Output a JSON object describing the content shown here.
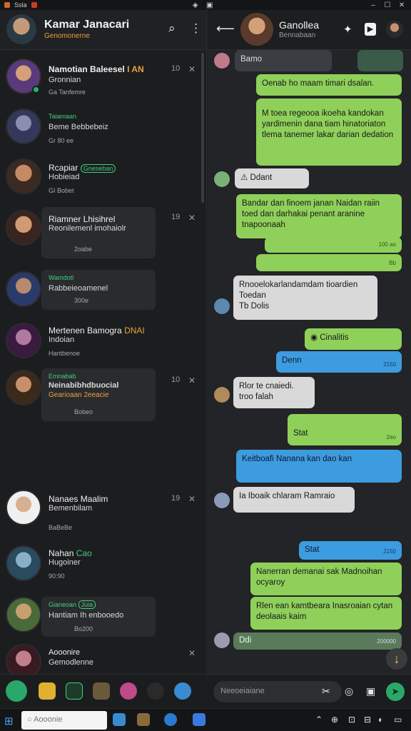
{
  "system_bar": {
    "left_text": "Ssla",
    "right_icons": [
      "shield-icon",
      "tray-icon",
      "tray-icon"
    ]
  },
  "left": {
    "header": {
      "title": "Kamar Janacari",
      "subtitle": "Genomonerne"
    },
    "chats": [
      {
        "name": "Namotian Baleesel",
        "name_tag": "I AN",
        "preview": "Gronnian",
        "meta": "Ga Tanfemre",
        "time": "10"
      },
      {
        "name": "Taiamaan",
        "preview": "Beme Bebbebeiz",
        "meta": "Gr  80 ee",
        "time": ""
      },
      {
        "name": "Rcapiar",
        "name_tag": "Gneseban",
        "preview": "Hobieiad",
        "meta": "GI  Bobet",
        "time": ""
      },
      {
        "name": "Riamner Lhisihrel",
        "preview": "Reonilemenl imohaiolr",
        "meta": "2oabe",
        "time": "19"
      },
      {
        "name": "Wamdotl",
        "preview": "Rabbeieoamenel",
        "meta": "300e",
        "time": ""
      },
      {
        "name": "Mertenen Bamogra",
        "name_tag": "DNAI",
        "preview": "Indoian",
        "meta": "Hantbenoe",
        "time": ""
      },
      {
        "name": "Emnabab",
        "preview": "Neinabibhdbuocial",
        "preview2": "Gearioaan",
        "meta_tag": "2eeacie",
        "meta": "Bobeo",
        "time": "10"
      },
      {
        "name": "Nanaes Maalim",
        "preview": "Bemenbilam",
        "meta": "BaBeBe",
        "time": "19"
      },
      {
        "name": "Nahan",
        "name_tag": "Cao",
        "preview": "Hugoiner",
        "meta": "90:90",
        "time": ""
      },
      {
        "name": "Gianeoan",
        "name_tag": "Juia",
        "preview": "Hantiam Ih enbooedo",
        "meta": "Bo200",
        "time": ""
      },
      {
        "name": "Aooonire",
        "preview": "Gemodlenne",
        "meta": "",
        "time": ""
      }
    ]
  },
  "right": {
    "header": {
      "title": "Ganollea",
      "subtitle": "Bennabaan"
    },
    "messages": [
      {
        "dir": "in",
        "text": "Bamo",
        "status": ""
      },
      {
        "dir": "out",
        "text": "Oenab ho maam timari dsalan.",
        "status": ""
      },
      {
        "dir": "out",
        "text": "M toea regeooa ikoeha kandokan yardimenin dana tiam hinatoriaton tlema tanemer lakar darian dedation",
        "status": ""
      },
      {
        "dir": "in",
        "text": "Ddant",
        "status": ""
      },
      {
        "dir": "out",
        "text": "Bandar dan finoem janan Naidan raiin toed dan darhakai penant aranine tnapoonaah",
        "status": "100 ao"
      },
      {
        "dir": "out",
        "text": "",
        "status": "Bb"
      },
      {
        "dir": "in",
        "text": "Rnooelokarlandamdam tioardien Toedan",
        "sub": "Tb  Dolis",
        "status": ""
      },
      {
        "dir": "out",
        "text": "Cinalitis",
        "status": ""
      },
      {
        "dir": "blue",
        "text": "Denn",
        "status": "2150"
      },
      {
        "dir": "in",
        "text": "Rlor te cnaiedi. troo falah",
        "status": ""
      },
      {
        "dir": "out",
        "text": "Stat",
        "status": "2eo"
      },
      {
        "dir": "blue",
        "text": "Keitboafi Nanana kan dao kan",
        "status": ""
      },
      {
        "dir": "in",
        "text": "Ia Iboaik chlaram Ramraio",
        "status": ""
      },
      {
        "dir": "blue",
        "text": "Stat",
        "status": "2150"
      },
      {
        "dir": "out",
        "text": "Nanerran demanai sak Madnoihan ocyaroy",
        "status": ""
      },
      {
        "dir": "out",
        "text": "Rlen ean kamtbeara Inasroaian cytan deolaais kaim",
        "status": ""
      },
      {
        "dir": "out",
        "text": "Ddi",
        "status": "200000"
      }
    ],
    "input_placeholder": "Neeoeiaiane"
  },
  "taskbar": {
    "search_placeholder": "Aooonie"
  },
  "colors": {
    "accent_green": "#8fd05a",
    "accent_blue": "#3d9be0",
    "online": "#27b26e",
    "highlight": "#e8a23c"
  }
}
